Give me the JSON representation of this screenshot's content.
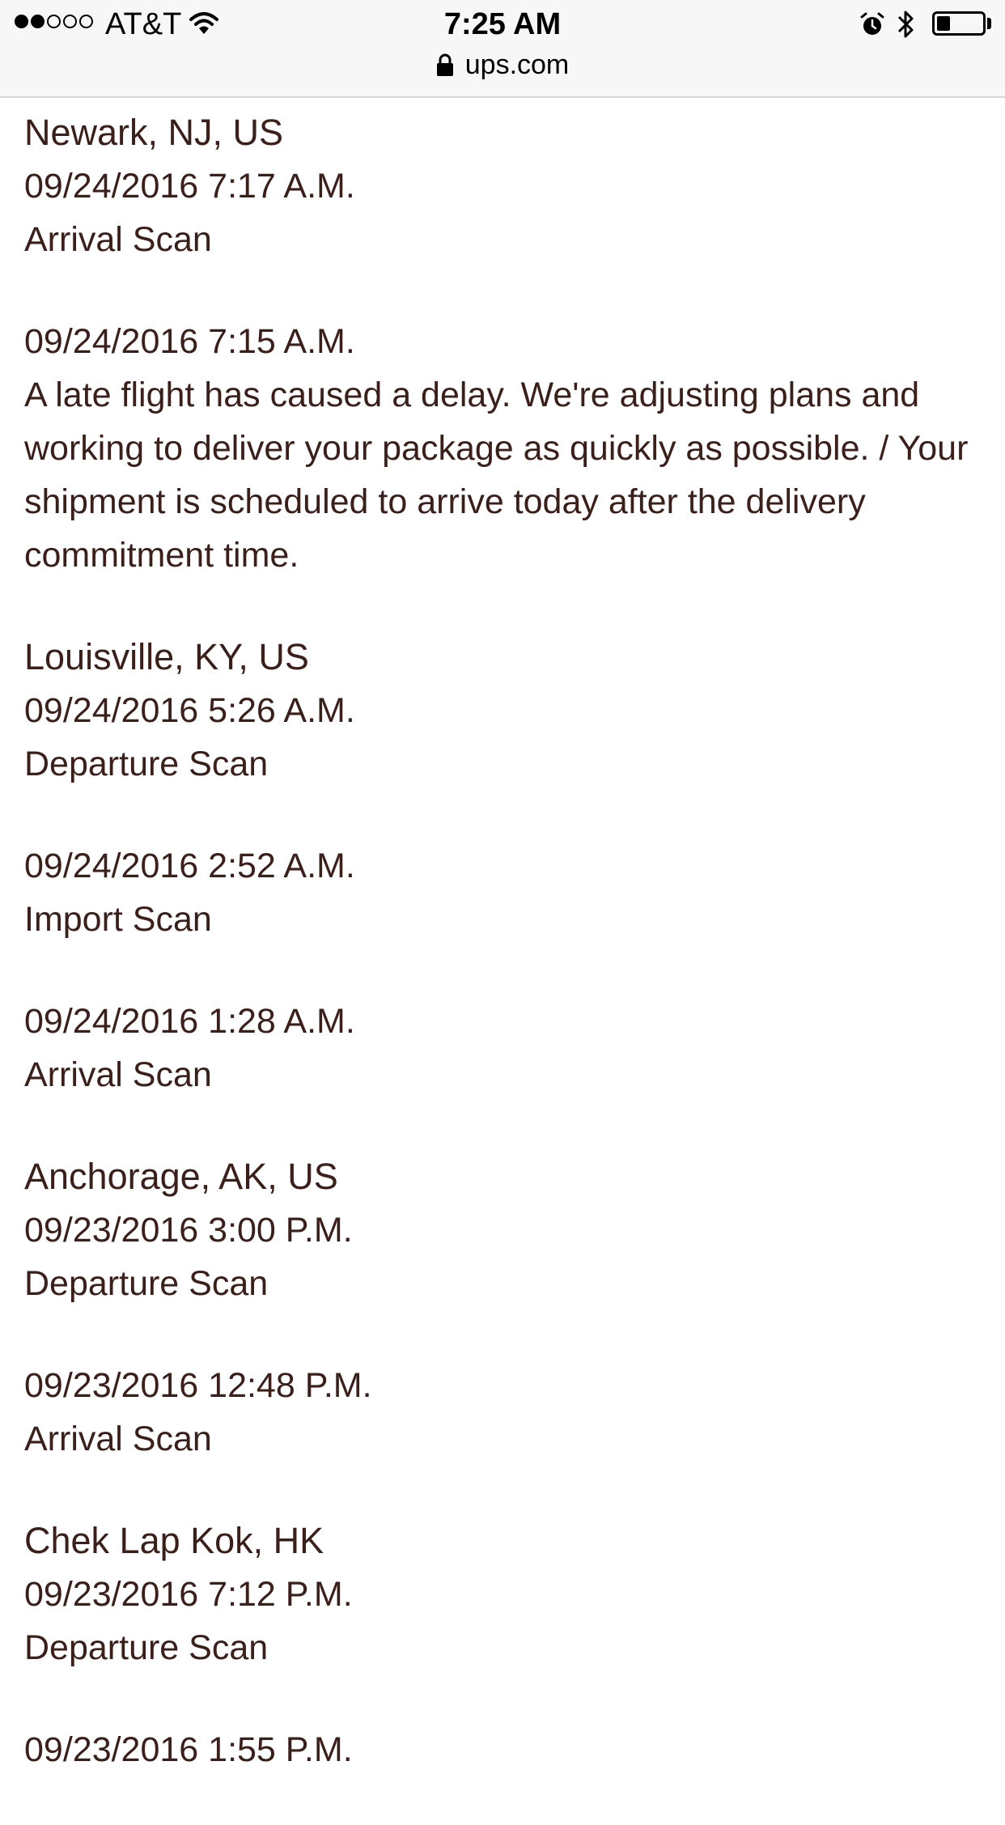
{
  "status_bar": {
    "carrier": "AT&T",
    "time": "7:25 AM",
    "url": "ups.com",
    "signal_bars_filled": 2,
    "signal_bars_total": 5,
    "battery_level_percent": 30,
    "icons": [
      "wifi-icon",
      "lock-icon",
      "alarm-icon",
      "bluetooth-icon",
      "battery-icon"
    ]
  },
  "groups": [
    {
      "location": "Newark, NJ, US",
      "entries": [
        {
          "datetime": "09/24/2016 7:17 A.M.",
          "activity": "Arrival Scan"
        },
        {
          "datetime": "09/24/2016 7:15 A.M.",
          "activity": "A late flight has caused a delay. We're adjusting plans and working to deliver your package as quickly as possible. / Your shipment is scheduled to arrive today after the delivery commitment time."
        }
      ]
    },
    {
      "location": "Louisville, KY, US",
      "entries": [
        {
          "datetime": "09/24/2016 5:26 A.M.",
          "activity": "Departure Scan"
        },
        {
          "datetime": "09/24/2016 2:52 A.M.",
          "activity": "Import Scan"
        },
        {
          "datetime": "09/24/2016 1:28 A.M.",
          "activity": "Arrival Scan"
        }
      ]
    },
    {
      "location": "Anchorage, AK, US",
      "entries": [
        {
          "datetime": "09/23/2016 3:00 P.M.",
          "activity": "Departure Scan"
        },
        {
          "datetime": "09/23/2016 12:48 P.M.",
          "activity": "Arrival Scan"
        }
      ]
    },
    {
      "location": "Chek Lap Kok, HK",
      "entries": [
        {
          "datetime": "09/23/2016 7:12 P.M.",
          "activity": "Departure Scan"
        },
        {
          "datetime": "09/23/2016 1:55 P.M.",
          "activity": ""
        }
      ]
    }
  ]
}
